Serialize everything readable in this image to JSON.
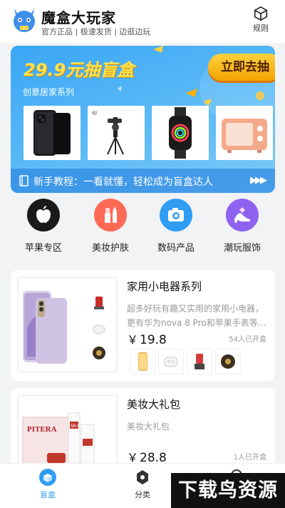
{
  "header": {
    "app_name": "魔盒大玩家",
    "slogan": "官方正品 | 极速发货 | 边逛边玩",
    "rules_label": "规则"
  },
  "banner": {
    "title": "29.9元抽盲盒",
    "subtitle": "创意居家系列",
    "cta": "立即去抽",
    "product_icons": [
      "smartphone-icon",
      "gimbal-icon",
      "smartwatch-icon",
      "oven-icon"
    ],
    "tutorial_text": "新手教程：一看就懂，轻松成为盲盒达人",
    "tutorial_arrow": "▶▶▶"
  },
  "categories": [
    {
      "label": "苹果专区",
      "icon": "apple-icon",
      "color": "#1a1a1a"
    },
    {
      "label": "美妆护肤",
      "icon": "cosmetics-icon",
      "color": "#ff6a55"
    },
    {
      "label": "数码产品",
      "icon": "camera-icon",
      "color": "#2f9df3"
    },
    {
      "label": "潮玩服饰",
      "icon": "high-heel-icon",
      "color": "#8e63f0"
    }
  ],
  "cards": [
    {
      "title": "家用小电器系列",
      "desc": "超多好玩有趣又实用的家用小电器，更有华为nova 8 Pro和苹果手表等...",
      "yen": "￥",
      "price": "19.8",
      "count": "54人已开盒"
    },
    {
      "title": "美妆大礼包",
      "desc": "美妆大礼包",
      "yen": "￥",
      "price": "28.8",
      "count": "1人已开盒"
    }
  ],
  "tabs": [
    {
      "label": "盲盒",
      "icon": "blind-box-icon",
      "active": true
    },
    {
      "label": "分类",
      "icon": "category-icon",
      "active": false
    }
  ],
  "watermark": "下载鸟资源",
  "colors": {
    "accent": "#2f9df3",
    "banner_title": "#ffe34d",
    "cta": "#f5a300"
  }
}
